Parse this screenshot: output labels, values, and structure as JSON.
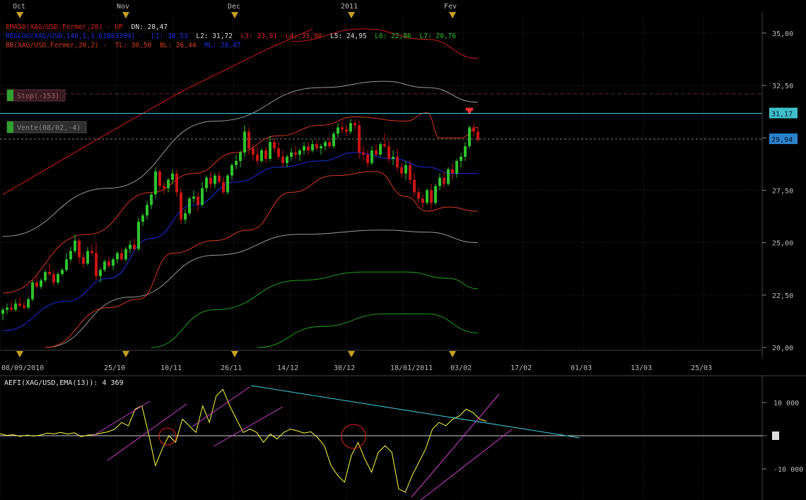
{
  "months": [
    "Oct",
    "Nov",
    "Dec",
    "2011",
    "Fev"
  ],
  "x_axis_dates": [
    "08/09/2010",
    "25/10",
    "10/11",
    "26/11",
    "14/12",
    "30/12",
    "18/01/2011",
    "03/02",
    "17/02",
    "01/03",
    "13/03",
    "25/03"
  ],
  "price_axis_ticks": [
    "35,00",
    "32,50",
    "30,00",
    "27,50",
    "25,00",
    "22,50",
    "20,00"
  ],
  "price_tick_values": [
    35,
    32.5,
    30,
    27.5,
    25,
    22.5,
    20
  ],
  "price_badges": [
    {
      "label": "31,17",
      "value": 31.17,
      "color": "#40c0c8"
    },
    {
      "label": "29,94",
      "value": 29.94,
      "color": "#2a82c8"
    }
  ],
  "indicator_labels": {
    "ema": {
      "name": "EMA50(XAG/USD.Fermer,20) - UP",
      "dn_label": "DN: 28,47"
    },
    "regression": {
      "name": "REGLOG(XAG/USD,140,1,1.61803399) -",
      "levels": [
        "L1: 30,53",
        "L2: 31,72",
        "L3: 33,81",
        "L4: 35,90",
        "L5: 24,95",
        "L6: 22,86",
        "L7: 20,76"
      ]
    },
    "bollinger": {
      "name": "BB(XAG/USD.Fermer,20,2) -",
      "tl": "TL: 30,50",
      "bl": "BL: 26,44",
      "ml": "ML: 28,47"
    }
  },
  "order_tags": {
    "stop": "Stop(-153)",
    "vente": "Vente(08/02,-4)"
  },
  "oscillator": {
    "label": "AEFI(XAG/USD,EMA(13)): 4 369",
    "axis_ticks": [
      "10 000",
      "0",
      "-10 000"
    ],
    "tick_values": [
      10000,
      0,
      -10000
    ]
  },
  "colors": {
    "background": "#000000",
    "grid": "#2b2b2b",
    "up_candle": "#2ec22e",
    "down_candle": "#c81414",
    "bollinger": "#d83a20",
    "ema": "#1c2ee0",
    "reg_upper": "#d41a1a",
    "reg_gray": "#9a9a9a",
    "reg_lower": "#20a020",
    "resistance": "#40d0e0",
    "oscillator": "#ffff40",
    "channel": "#d040d0",
    "circle": "#e02020"
  },
  "chart_data": {
    "type": "candlestick",
    "symbol": "XAG/USD",
    "ylim": [
      20,
      35.5
    ],
    "resistance_line": 31.17,
    "last_price": 29.94,
    "candles": [
      [
        21.6,
        21.9,
        21.3,
        21.8
      ],
      [
        21.8,
        22.1,
        21.6,
        21.9
      ],
      [
        21.9,
        22.2,
        21.7,
        21.8
      ],
      [
        21.8,
        22.3,
        21.7,
        22.1
      ],
      [
        22.1,
        22.4,
        21.9,
        22.0
      ],
      [
        22.0,
        22.2,
        21.8,
        21.9
      ],
      [
        21.9,
        22.4,
        21.8,
        22.3
      ],
      [
        22.3,
        23.2,
        22.2,
        23.1
      ],
      [
        23.1,
        23.4,
        22.8,
        22.9
      ],
      [
        22.9,
        23.3,
        22.8,
        23.2
      ],
      [
        23.2,
        23.7,
        23.1,
        23.6
      ],
      [
        23.6,
        24.0,
        23.4,
        23.5
      ],
      [
        23.5,
        23.7,
        22.9,
        23.1
      ],
      [
        23.1,
        23.6,
        23.0,
        23.5
      ],
      [
        23.5,
        23.8,
        23.4,
        23.7
      ],
      [
        23.7,
        24.5,
        23.6,
        24.2
      ],
      [
        24.2,
        24.8,
        24.1,
        24.6
      ],
      [
        24.6,
        25.4,
        24.5,
        25.1
      ],
      [
        25.1,
        25.2,
        24.0,
        24.3
      ],
      [
        24.3,
        24.5,
        23.8,
        24.0
      ],
      [
        24.0,
        24.8,
        23.9,
        24.6
      ],
      [
        24.6,
        24.9,
        24.4,
        24.5
      ],
      [
        24.5,
        25.0,
        23.2,
        23.4
      ],
      [
        23.4,
        23.8,
        23.1,
        23.7
      ],
      [
        23.7,
        24.2,
        23.6,
        24.1
      ],
      [
        24.1,
        24.3,
        23.8,
        23.9
      ],
      [
        23.9,
        24.3,
        23.7,
        24.2
      ],
      [
        24.2,
        24.6,
        24.0,
        24.5
      ],
      [
        24.5,
        24.7,
        24.1,
        24.2
      ],
      [
        24.2,
        24.8,
        24.1,
        24.7
      ],
      [
        24.7,
        25.1,
        24.5,
        24.9
      ],
      [
        24.9,
        25.2,
        24.6,
        24.7
      ],
      [
        24.7,
        26.2,
        24.6,
        26.0
      ],
      [
        26.0,
        26.4,
        25.8,
        26.3
      ],
      [
        26.3,
        27.0,
        26.1,
        26.8
      ],
      [
        26.8,
        27.4,
        26.6,
        27.3
      ],
      [
        27.3,
        28.6,
        27.1,
        28.4
      ],
      [
        28.4,
        28.5,
        27.5,
        27.7
      ],
      [
        27.7,
        27.9,
        27.3,
        27.6
      ],
      [
        27.6,
        28.1,
        27.4,
        28.0
      ],
      [
        28.0,
        28.5,
        27.8,
        28.3
      ],
      [
        28.3,
        28.5,
        27.2,
        27.4
      ],
      [
        27.4,
        27.6,
        25.9,
        26.1
      ],
      [
        26.1,
        26.6,
        25.9,
        26.4
      ],
      [
        26.4,
        27.2,
        26.3,
        27.1
      ],
      [
        27.1,
        27.5,
        26.9,
        27.2
      ],
      [
        27.2,
        27.4,
        26.5,
        26.8
      ],
      [
        26.8,
        27.9,
        26.7,
        27.6
      ],
      [
        27.6,
        28.2,
        27.4,
        28.1
      ],
      [
        28.1,
        28.4,
        27.6,
        27.8
      ],
      [
        27.8,
        28.3,
        27.6,
        28.2
      ],
      [
        28.2,
        28.4,
        27.8,
        27.9
      ],
      [
        27.9,
        28.1,
        27.3,
        27.4
      ],
      [
        27.4,
        28.3,
        27.3,
        28.2
      ],
      [
        28.2,
        28.8,
        28.0,
        28.7
      ],
      [
        28.7,
        29.2,
        28.5,
        28.9
      ],
      [
        28.9,
        29.4,
        28.6,
        29.3
      ],
      [
        29.3,
        30.6,
        29.1,
        30.3
      ],
      [
        30.3,
        30.5,
        29.2,
        29.5
      ],
      [
        29.5,
        29.7,
        28.9,
        29.2
      ],
      [
        29.2,
        29.6,
        28.7,
        28.9
      ],
      [
        28.9,
        29.5,
        28.8,
        29.4
      ],
      [
        29.4,
        29.6,
        28.8,
        29.0
      ],
      [
        29.0,
        30.1,
        28.9,
        29.8
      ],
      [
        29.8,
        30.0,
        29.3,
        29.5
      ],
      [
        29.5,
        29.8,
        29.0,
        29.1
      ],
      [
        29.1,
        29.4,
        28.6,
        28.8
      ],
      [
        28.8,
        29.2,
        28.6,
        29.1
      ],
      [
        29.1,
        29.5,
        28.9,
        29.3
      ],
      [
        29.3,
        29.6,
        29.0,
        29.2
      ],
      [
        29.2,
        29.5,
        28.9,
        29.4
      ],
      [
        29.4,
        29.8,
        29.2,
        29.6
      ],
      [
        29.6,
        29.8,
        29.2,
        29.4
      ],
      [
        29.4,
        29.9,
        29.3,
        29.7
      ],
      [
        29.7,
        29.9,
        29.4,
        29.5
      ],
      [
        29.5,
        29.7,
        29.2,
        29.6
      ],
      [
        29.6,
        29.9,
        29.4,
        29.8
      ],
      [
        29.8,
        30.0,
        29.5,
        29.6
      ],
      [
        29.6,
        30.3,
        29.5,
        30.2
      ],
      [
        30.2,
        30.7,
        30.0,
        30.5
      ],
      [
        30.5,
        30.8,
        30.2,
        30.4
      ],
      [
        30.4,
        30.6,
        30.1,
        30.3
      ],
      [
        30.3,
        30.9,
        30.2,
        30.7
      ],
      [
        30.7,
        30.9,
        30.4,
        30.6
      ],
      [
        30.6,
        30.8,
        29.0,
        29.3
      ],
      [
        29.3,
        29.6,
        28.9,
        29.2
      ],
      [
        29.2,
        29.4,
        28.6,
        28.8
      ],
      [
        28.8,
        29.6,
        28.7,
        29.4
      ],
      [
        29.4,
        29.7,
        29.1,
        29.2
      ],
      [
        29.2,
        29.8,
        29.1,
        29.7
      ],
      [
        29.7,
        30.2,
        29.5,
        29.6
      ],
      [
        29.6,
        29.9,
        28.8,
        29.0
      ],
      [
        29.0,
        29.4,
        28.7,
        29.1
      ],
      [
        29.1,
        29.5,
        28.4,
        28.6
      ],
      [
        28.6,
        28.8,
        28.1,
        28.3
      ],
      [
        28.3,
        28.9,
        28.0,
        28.7
      ],
      [
        28.7,
        28.9,
        27.8,
        28.0
      ],
      [
        28.0,
        28.3,
        27.2,
        27.4
      ],
      [
        27.4,
        27.6,
        26.9,
        27.1
      ],
      [
        27.1,
        27.3,
        26.7,
        26.9
      ],
      [
        26.9,
        27.6,
        26.8,
        27.5
      ],
      [
        27.5,
        27.8,
        26.6,
        26.9
      ],
      [
        26.9,
        27.8,
        26.8,
        27.7
      ],
      [
        27.7,
        28.3,
        27.5,
        28.1
      ],
      [
        28.1,
        28.4,
        27.6,
        27.8
      ],
      [
        27.8,
        28.6,
        27.7,
        28.5
      ],
      [
        28.5,
        28.8,
        28.0,
        28.3
      ],
      [
        28.3,
        29.0,
        28.1,
        28.9
      ],
      [
        28.9,
        29.3,
        28.6,
        29.1
      ],
      [
        29.1,
        29.8,
        28.9,
        29.6
      ],
      [
        29.6,
        30.6,
        29.5,
        30.5
      ],
      [
        30.5,
        30.7,
        30.1,
        30.3
      ],
      [
        30.3,
        30.5,
        29.8,
        29.9
      ]
    ],
    "bollinger_upper": [
      [
        0,
        22.6
      ],
      [
        20,
        25.4
      ],
      [
        35,
        27.4
      ],
      [
        45,
        28.3
      ],
      [
        55,
        29.3
      ],
      [
        65,
        30.1
      ],
      [
        75,
        30.6
      ],
      [
        83,
        31.0
      ],
      [
        95,
        30.8
      ],
      [
        100,
        31.2
      ],
      [
        103,
        30.0
      ],
      [
        108,
        30.0
      ],
      [
        112,
        30.5
      ]
    ],
    "bollinger_lower": [
      [
        10,
        20.0
      ],
      [
        25,
        21.9
      ],
      [
        32,
        22.3
      ],
      [
        40,
        24.5
      ],
      [
        50,
        25.1
      ],
      [
        58,
        25.6
      ],
      [
        68,
        27.4
      ],
      [
        78,
        28.2
      ],
      [
        88,
        28.4
      ],
      [
        95,
        27.2
      ],
      [
        100,
        26.5
      ],
      [
        105,
        26.7
      ],
      [
        112,
        26.5
      ]
    ],
    "ema_line": [
      [
        0,
        20.8
      ],
      [
        15,
        22.2
      ],
      [
        25,
        23.3
      ],
      [
        35,
        25.2
      ],
      [
        45,
        26.8
      ],
      [
        55,
        27.9
      ],
      [
        65,
        28.6
      ],
      [
        75,
        28.9
      ],
      [
        83,
        29.3
      ],
      [
        92,
        29.0
      ],
      [
        100,
        28.6
      ],
      [
        106,
        28.3
      ],
      [
        112,
        28.3
      ]
    ],
    "regression_bands": [
      {
        "band": "upper",
        "points": [
          [
            0,
            27.5
          ],
          [
            20,
            30.2
          ],
          [
            40,
            32.8
          ],
          [
            60,
            34.6
          ],
          [
            70,
            35.6
          ]
        ]
      },
      {
        "band": "upper_mid",
        "points": [
          [
            0,
            33.9
          ],
          [
            0,
            33.9
          ]
        ]
      },
      {
        "band": "gray_upper",
        "points": [
          [
            0,
            25.3
          ],
          [
            25,
            27.6
          ],
          [
            50,
            30.8
          ],
          [
            75,
            32.4
          ],
          [
            90,
            32.7
          ],
          [
            100,
            32.4
          ],
          [
            112,
            31.7
          ]
        ]
      },
      {
        "band": "gray_lower",
        "points": [
          [
            10,
            20.0
          ],
          [
            30,
            22.4
          ],
          [
            50,
            24.4
          ],
          [
            70,
            25.4
          ],
          [
            90,
            25.6
          ],
          [
            100,
            25.5
          ],
          [
            112,
            25.0
          ]
        ]
      },
      {
        "band": "green_upper",
        "points": [
          [
            35,
            20.0
          ],
          [
            50,
            21.8
          ],
          [
            70,
            23.2
          ],
          [
            85,
            23.6
          ],
          [
            95,
            23.6
          ],
          [
            105,
            23.3
          ],
          [
            112,
            22.8
          ]
        ]
      },
      {
        "band": "green_lower",
        "points": [
          [
            60,
            20.0
          ],
          [
            75,
            21.0
          ],
          [
            90,
            21.6
          ],
          [
            100,
            21.6
          ],
          [
            112,
            20.7
          ]
        ]
      }
    ],
    "upper_red_line": [
      [
        0,
        27.3
      ],
      [
        22,
        29.9
      ],
      [
        42,
        32.2
      ],
      [
        62,
        34.2
      ],
      [
        73,
        35.2
      ]
    ],
    "upper_right_curve": [
      [
        68,
        34.6
      ],
      [
        85,
        35.2
      ],
      [
        100,
        34.7
      ],
      [
        112,
        33.8
      ]
    ],
    "oscillator_values": [
      600,
      100,
      300,
      -200,
      200,
      -100,
      200,
      800,
      600,
      1000,
      500,
      900,
      -300,
      200,
      300,
      800,
      1200,
      2000,
      4000,
      3000,
      8000,
      9000,
      500,
      -9000,
      -4000,
      0,
      -2000,
      5000,
      3000,
      1000,
      9000,
      4000,
      12000,
      14000,
      9000,
      5000,
      1000,
      2000,
      1000,
      -2000,
      500,
      -1000,
      1000,
      2000,
      1500,
      800,
      1200,
      -500,
      -3000,
      -9000,
      -12000,
      -14000,
      -6000,
      -2000,
      -7000,
      -11000,
      -5000,
      -3000,
      -5000,
      -16000,
      -17000,
      -12000,
      -8000,
      -4000,
      2000,
      4000,
      3000,
      5000,
      6000,
      8000,
      7000,
      5000,
      4369
    ],
    "channels": [
      {
        "from": [
          130,
          618
        ],
        "to": [
          212,
          568
        ],
        "from2": [
          152,
          652
        ],
        "to2": [
          264,
          572
        ]
      },
      {
        "from": [
          272,
          604
        ],
        "to": [
          353,
          548
        ],
        "from2": [
          302,
          632
        ],
        "to2": [
          400,
          576
        ]
      },
      {
        "from": [
          582,
          704
        ],
        "to": [
          706,
          558
        ],
        "from2": [
          595,
          708
        ],
        "to2": [
          724,
          608
        ]
      }
    ],
    "trendline": {
      "from": [
        355,
        546
      ],
      "to": [
        820,
        620
      ]
    },
    "circles": [
      {
        "cx": 237,
        "cy": 618,
        "r": 12
      },
      {
        "cx": 500,
        "cy": 618,
        "r": 17
      }
    ],
    "signal_arrow_price": 31.1
  }
}
